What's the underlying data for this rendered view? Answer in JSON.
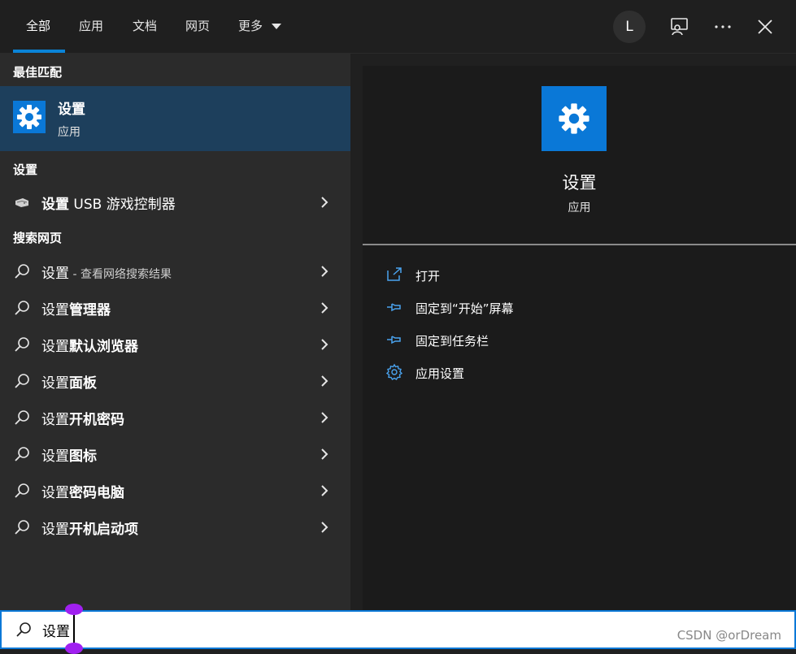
{
  "tabs": [
    {
      "label": "全部"
    },
    {
      "label": "应用"
    },
    {
      "label": "文档"
    },
    {
      "label": "网页"
    },
    {
      "label": "更多"
    }
  ],
  "header": {
    "avatar_letter": "L"
  },
  "left": {
    "best_match_title": "最佳匹配",
    "best_match": {
      "title": "设置",
      "subtitle": "应用"
    },
    "settings_section_title": "设置",
    "settings_item": {
      "bold": "设置",
      "rest": " USB 游戏控制器"
    },
    "web_section_title": "搜索网页",
    "web_items": [
      {
        "prefix": "设置",
        "bold": "",
        "suffix": " - 查看网络搜索结果"
      },
      {
        "prefix": "设置",
        "bold": "管理器",
        "suffix": ""
      },
      {
        "prefix": "设置",
        "bold": "默认浏览器",
        "suffix": ""
      },
      {
        "prefix": "设置",
        "bold": "面板",
        "suffix": ""
      },
      {
        "prefix": "设置",
        "bold": "开机密码",
        "suffix": ""
      },
      {
        "prefix": "设置",
        "bold": "图标",
        "suffix": ""
      },
      {
        "prefix": "设置",
        "bold": "密码电脑",
        "suffix": ""
      },
      {
        "prefix": "设置",
        "bold": "开机启动项",
        "suffix": ""
      }
    ]
  },
  "right": {
    "title": "设置",
    "subtitle": "应用",
    "actions": [
      {
        "label": "打开"
      },
      {
        "label": "固定到“开始”屏幕"
      },
      {
        "label": "固定到任务栏"
      },
      {
        "label": "应用设置"
      }
    ]
  },
  "search": {
    "value": "设置",
    "watermark": "CSDN @orDream"
  },
  "colors": {
    "accent": "#0a78d7",
    "selected": "#1d3f5c",
    "panel_left": "#2b2b2b",
    "panel_right": "#1b1b1b"
  }
}
